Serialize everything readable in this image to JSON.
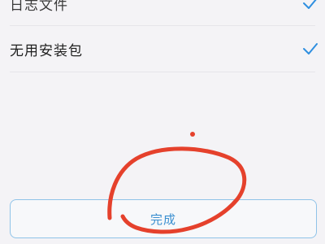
{
  "list": {
    "items": [
      {
        "label": "日志文件",
        "checked": true
      },
      {
        "label": "无用安装包",
        "checked": true
      }
    ],
    "check_color": "#2f8fe0"
  },
  "footer": {
    "done_label": "完成",
    "accent": "#3a8fd0"
  },
  "annotation": {
    "color": "#e5412c",
    "kind": "hand-drawn circle around done button"
  }
}
